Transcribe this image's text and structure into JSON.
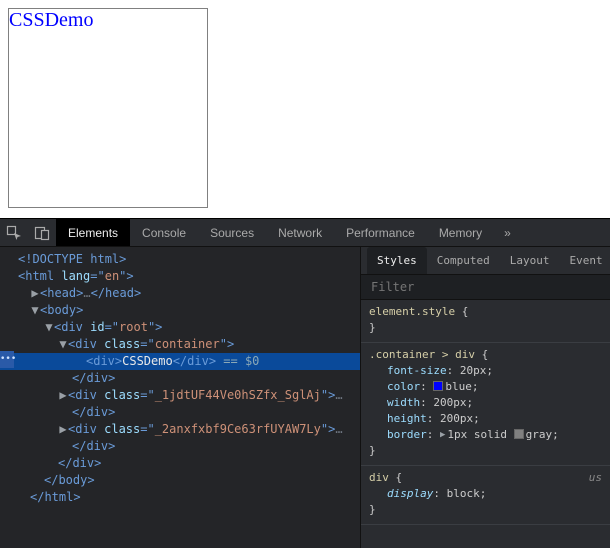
{
  "demo": {
    "text": "CSSDemo"
  },
  "toolbar": {
    "tabs": [
      "Elements",
      "Console",
      "Sources",
      "Network",
      "Performance",
      "Memory"
    ],
    "more": "»"
  },
  "dom": {
    "doctype": "<!DOCTYPE html>",
    "html_open_pre": "<html ",
    "lang_attr": "lang",
    "lang_val": "en",
    "html_open_post": ">",
    "head_open": "<head>",
    "ellipsis": "…",
    "head_close": "</head>",
    "body_open": "<body>",
    "root_pre": "<div ",
    "id_attr": "id",
    "root_val": "root",
    "tag_end": ">",
    "container_pre": "<div ",
    "class_attr": "class",
    "container_val": "container",
    "inner_open": "<div>",
    "inner_text": "CSSDemo",
    "inner_close": "</div>",
    "sel_marker": " == $0",
    "div_close": "</div>",
    "gen1_val": "_1jdtUF44Ve0hSZfx_SglAj",
    "gen2_val": "_2anxfxbf9Ce63rfUYAW7Ly",
    "body_close": "</body>",
    "html_close": "</html>",
    "dots": "•••"
  },
  "styles": {
    "tabs": [
      "Styles",
      "Computed",
      "Layout",
      "Event"
    ],
    "filter_placeholder": "Filter",
    "inline_selector": "element.style",
    "rule1": {
      "selector": ".container > div",
      "props": {
        "font_size_n": "font-size",
        "font_size_v": "20px;",
        "color_n": "color",
        "color_v": "blue;",
        "width_n": "width",
        "width_v": "200px;",
        "height_n": "height",
        "height_v": "200px;",
        "border_n": "border",
        "border_v_pre": "1px solid ",
        "border_v_color": "gray;"
      }
    },
    "rule2": {
      "selector": "div",
      "origin": "us",
      "display_n": "display",
      "display_v": "block;"
    },
    "brace_open": " {",
    "brace_close": "}"
  }
}
